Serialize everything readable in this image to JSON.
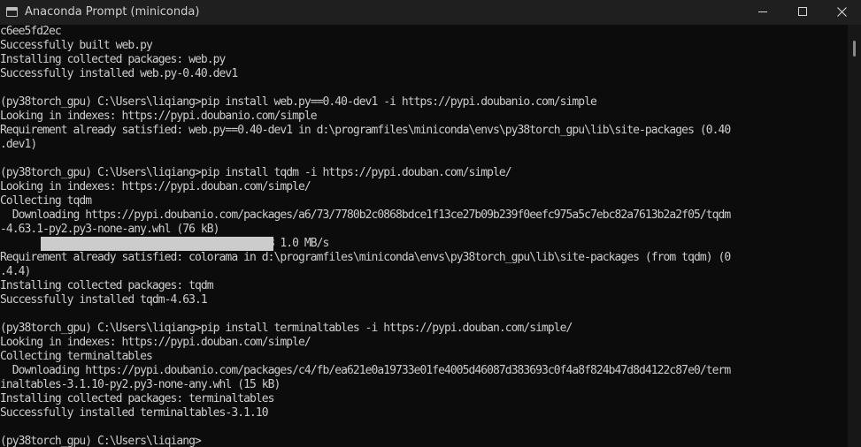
{
  "window": {
    "title": "Anaconda Prompt (miniconda)"
  },
  "terminal": {
    "lines": [
      "c6ee5fd2ec",
      "Successfully built web.py",
      "Installing collected packages: web.py",
      "Successfully installed web.py-0.40.dev1",
      "",
      "(py38torch_gpu) C:\\Users\\liqiang>pip install web.py==0.40-dev1 -i https://pypi.doubanio.com/simple",
      "Looking in indexes: https://pypi.doubanio.com/simple",
      "Requirement already satisfied: web.py==0.40-dev1 in d:\\programfiles\\miniconda\\envs\\py38torch_gpu\\lib\\site-packages (0.40",
      ".dev1)",
      "",
      "(py38torch_gpu) C:\\Users\\liqiang>pip install tqdm -i https://pypi.douban.com/simple/",
      "Looking in indexes: https://pypi.douban.com/simple/",
      "Collecting tqdm",
      "  Downloading https://pypi.doubanio.com/packages/a6/73/7780b2c0868bdce1f13ce27b09b239f0eefc975a5c7ebc82a7613b2a2f05/tqdm",
      "-4.63.1-py2.py3-none-any.whl (76 kB)",
      "                                        76 kB 1.0 MB/s",
      "Requirement already satisfied: colorama in d:\\programfiles\\miniconda\\envs\\py38torch_gpu\\lib\\site-packages (from tqdm) (0",
      ".4.4)",
      "Installing collected packages: tqdm",
      "Successfully installed tqdm-4.63.1",
      "",
      "(py38torch_gpu) C:\\Users\\liqiang>pip install terminaltables -i https://pypi.douban.com/simple/",
      "Looking in indexes: https://pypi.douban.com/simple/",
      "Collecting terminaltables",
      "  Downloading https://pypi.doubanio.com/packages/c4/fb/ea621e0a19733e01fe4005d46087d383693c0f4a8f824b47d8d4122c87e0/term",
      "inaltables-3.1.10-py2.py3-none-any.whl (15 kB)",
      "Installing collected packages: terminaltables",
      "Successfully installed terminaltables-3.1.10",
      "",
      "(py38torch_gpu) C:\\Users\\liqiang>"
    ],
    "download_progress": 1.0
  },
  "icons": {
    "app": "terminal-window-icon",
    "minimize": "minimize-icon",
    "maximize": "maximize-icon",
    "close": "close-icon"
  },
  "colors": {
    "background": "#0c0c0c",
    "text": "#cccccc",
    "titlebar": "#1f1f1f"
  }
}
